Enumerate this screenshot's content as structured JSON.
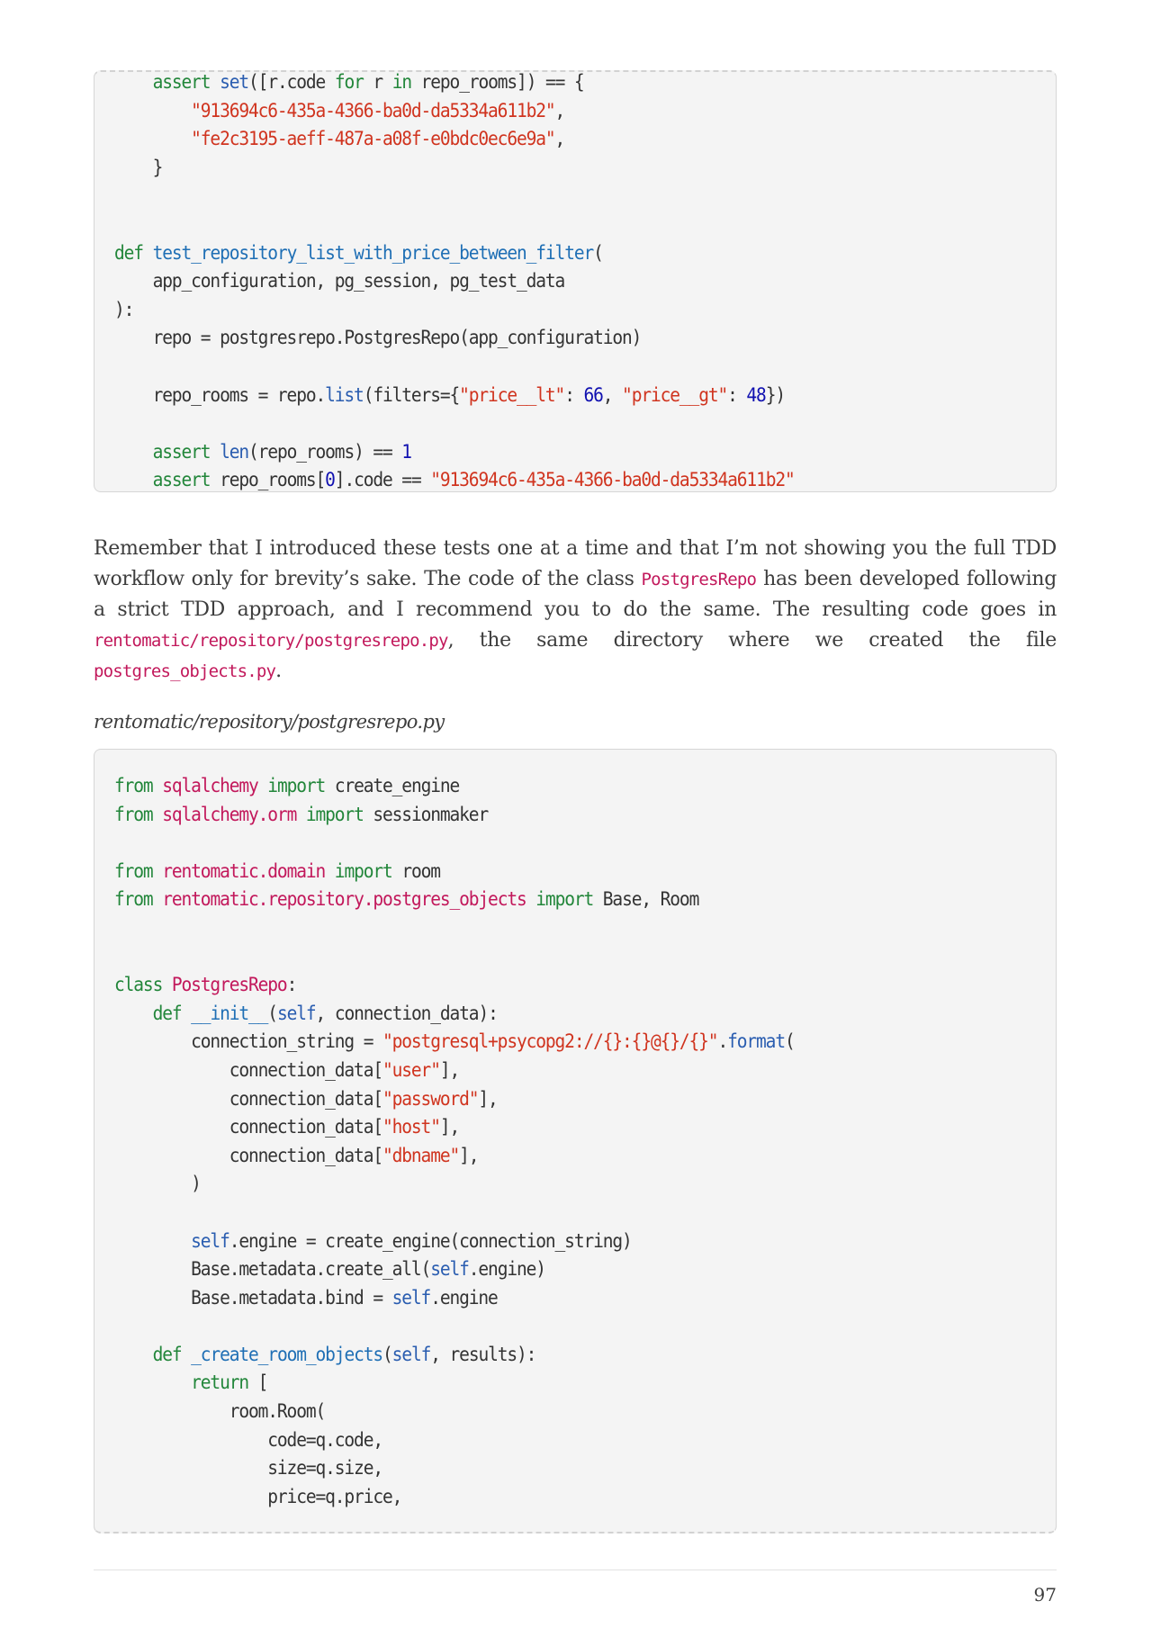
{
  "colors": {
    "keyword": "#22863a",
    "keyword_green": "#1e8a1e",
    "builtin": "#2a5db0",
    "function_name": "#1f6fb5",
    "string": "#d0341f",
    "number": "#1010b0",
    "module": "#c2185b",
    "class_name": "#c2185b",
    "plain": "#333333",
    "inline_code": "#c2185b"
  },
  "code_block_1": {
    "lines": [
      [
        [
          "plain",
          "    "
        ],
        [
          "keyword",
          "assert"
        ],
        [
          "plain",
          " "
        ],
        [
          "builtin",
          "set"
        ],
        [
          "plain",
          "([r.code "
        ],
        [
          "keyword",
          "for"
        ],
        [
          "plain",
          " r "
        ],
        [
          "keyword",
          "in"
        ],
        [
          "plain",
          " repo_rooms]) == {"
        ]
      ],
      [
        [
          "plain",
          "        "
        ],
        [
          "string",
          "\"913694c6-435a-4366-ba0d-da5334a611b2\""
        ],
        [
          "plain",
          ","
        ]
      ],
      [
        [
          "plain",
          "        "
        ],
        [
          "string",
          "\"fe2c3195-aeff-487a-a08f-e0bdc0ec6e9a\""
        ],
        [
          "plain",
          ","
        ]
      ],
      [
        [
          "plain",
          "    }"
        ]
      ],
      [
        [
          "plain",
          ""
        ]
      ],
      [
        [
          "plain",
          ""
        ]
      ],
      [
        [
          "keyword",
          "def"
        ],
        [
          "plain",
          " "
        ],
        [
          "function_name",
          "test_repository_list_with_price_between_filter"
        ],
        [
          "plain",
          "("
        ]
      ],
      [
        [
          "plain",
          "    app_configuration, pg_session, pg_test_data"
        ]
      ],
      [
        [
          "plain",
          "):"
        ]
      ],
      [
        [
          "plain",
          "    repo = postgresrepo.PostgresRepo(app_configuration)"
        ]
      ],
      [
        [
          "plain",
          ""
        ]
      ],
      [
        [
          "plain",
          "    repo_rooms = repo."
        ],
        [
          "builtin",
          "list"
        ],
        [
          "plain",
          "(filters={"
        ],
        [
          "string",
          "\"price__lt\""
        ],
        [
          "plain",
          ": "
        ],
        [
          "number",
          "66"
        ],
        [
          "plain",
          ", "
        ],
        [
          "string",
          "\"price__gt\""
        ],
        [
          "plain",
          ": "
        ],
        [
          "number",
          "48"
        ],
        [
          "plain",
          "})"
        ]
      ],
      [
        [
          "plain",
          ""
        ]
      ],
      [
        [
          "plain",
          "    "
        ],
        [
          "keyword",
          "assert"
        ],
        [
          "plain",
          " "
        ],
        [
          "builtin",
          "len"
        ],
        [
          "plain",
          "(repo_rooms) == "
        ],
        [
          "number",
          "1"
        ]
      ],
      [
        [
          "plain",
          "    "
        ],
        [
          "keyword",
          "assert"
        ],
        [
          "plain",
          " repo_rooms["
        ],
        [
          "number",
          "0"
        ],
        [
          "plain",
          "].code == "
        ],
        [
          "string",
          "\"913694c6-435a-4366-ba0d-da5334a611b2\""
        ]
      ]
    ]
  },
  "paragraph": {
    "parts": [
      [
        "text",
        "Remember that I introduced these tests one at a time and that I’m not showing you the full TDD workflow only for brevity’s sake. The code of the class "
      ],
      [
        "code",
        "PostgresRepo"
      ],
      [
        "text",
        " has been developed following a strict TDD approach, and I recommend you to do the same. The resulting code goes in "
      ],
      [
        "code",
        "rentomatic/repository/postgresrepo.py"
      ],
      [
        "text",
        ", the same directory where we created the file "
      ],
      [
        "code",
        "postgres_objects.py"
      ],
      [
        "text",
        "."
      ]
    ]
  },
  "caption": "rentomatic/repository/postgresrepo.py",
  "code_block_2": {
    "lines": [
      [
        [
          "keyword",
          "from"
        ],
        [
          "plain",
          " "
        ],
        [
          "module",
          "sqlalchemy"
        ],
        [
          "plain",
          " "
        ],
        [
          "keyword",
          "import"
        ],
        [
          "plain",
          " create_engine"
        ]
      ],
      [
        [
          "keyword",
          "from"
        ],
        [
          "plain",
          " "
        ],
        [
          "module",
          "sqlalchemy.orm"
        ],
        [
          "plain",
          " "
        ],
        [
          "keyword",
          "import"
        ],
        [
          "plain",
          " sessionmaker"
        ]
      ],
      [
        [
          "plain",
          ""
        ]
      ],
      [
        [
          "keyword",
          "from"
        ],
        [
          "plain",
          " "
        ],
        [
          "module",
          "rentomatic.domain"
        ],
        [
          "plain",
          " "
        ],
        [
          "keyword",
          "import"
        ],
        [
          "plain",
          " room"
        ]
      ],
      [
        [
          "keyword",
          "from"
        ],
        [
          "plain",
          " "
        ],
        [
          "module",
          "rentomatic.repository.postgres_objects"
        ],
        [
          "plain",
          " "
        ],
        [
          "keyword",
          "import"
        ],
        [
          "plain",
          " Base, Room"
        ]
      ],
      [
        [
          "plain",
          ""
        ]
      ],
      [
        [
          "plain",
          ""
        ]
      ],
      [
        [
          "keyword",
          "class"
        ],
        [
          "plain",
          " "
        ],
        [
          "class_name",
          "PostgresRepo"
        ],
        [
          "plain",
          ":"
        ]
      ],
      [
        [
          "plain",
          "    "
        ],
        [
          "keyword",
          "def"
        ],
        [
          "plain",
          " "
        ],
        [
          "function_name",
          "__init__"
        ],
        [
          "plain",
          "("
        ],
        [
          "builtin",
          "self"
        ],
        [
          "plain",
          ", connection_data):"
        ]
      ],
      [
        [
          "plain",
          "        connection_string = "
        ],
        [
          "string",
          "\"postgresql+psycopg2://{}:{}@{}/{}\""
        ],
        [
          "plain",
          "."
        ],
        [
          "builtin",
          "format"
        ],
        [
          "plain",
          "("
        ]
      ],
      [
        [
          "plain",
          "            connection_data["
        ],
        [
          "string",
          "\"user\""
        ],
        [
          "plain",
          "],"
        ]
      ],
      [
        [
          "plain",
          "            connection_data["
        ],
        [
          "string",
          "\"password\""
        ],
        [
          "plain",
          "],"
        ]
      ],
      [
        [
          "plain",
          "            connection_data["
        ],
        [
          "string",
          "\"host\""
        ],
        [
          "plain",
          "],"
        ]
      ],
      [
        [
          "plain",
          "            connection_data["
        ],
        [
          "string",
          "\"dbname\""
        ],
        [
          "plain",
          "],"
        ]
      ],
      [
        [
          "plain",
          "        )"
        ]
      ],
      [
        [
          "plain",
          ""
        ]
      ],
      [
        [
          "plain",
          "        "
        ],
        [
          "builtin",
          "self"
        ],
        [
          "plain",
          ".engine = create_engine(connection_string)"
        ]
      ],
      [
        [
          "plain",
          "        Base.metadata.create_all("
        ],
        [
          "builtin",
          "self"
        ],
        [
          "plain",
          ".engine)"
        ]
      ],
      [
        [
          "plain",
          "        Base.metadata.bind = "
        ],
        [
          "builtin",
          "self"
        ],
        [
          "plain",
          ".engine"
        ]
      ],
      [
        [
          "plain",
          ""
        ]
      ],
      [
        [
          "plain",
          "    "
        ],
        [
          "keyword",
          "def"
        ],
        [
          "plain",
          " "
        ],
        [
          "function_name",
          "_create_room_objects"
        ],
        [
          "plain",
          "("
        ],
        [
          "builtin",
          "self"
        ],
        [
          "plain",
          ", results):"
        ]
      ],
      [
        [
          "plain",
          "        "
        ],
        [
          "keyword",
          "return"
        ],
        [
          "plain",
          " ["
        ]
      ],
      [
        [
          "plain",
          "            room.Room("
        ]
      ],
      [
        [
          "plain",
          "                code=q.code,"
        ]
      ],
      [
        [
          "plain",
          "                size=q.size,"
        ]
      ],
      [
        [
          "plain",
          "                price=q.price,"
        ]
      ]
    ]
  },
  "footer": {
    "page_number": "97"
  }
}
